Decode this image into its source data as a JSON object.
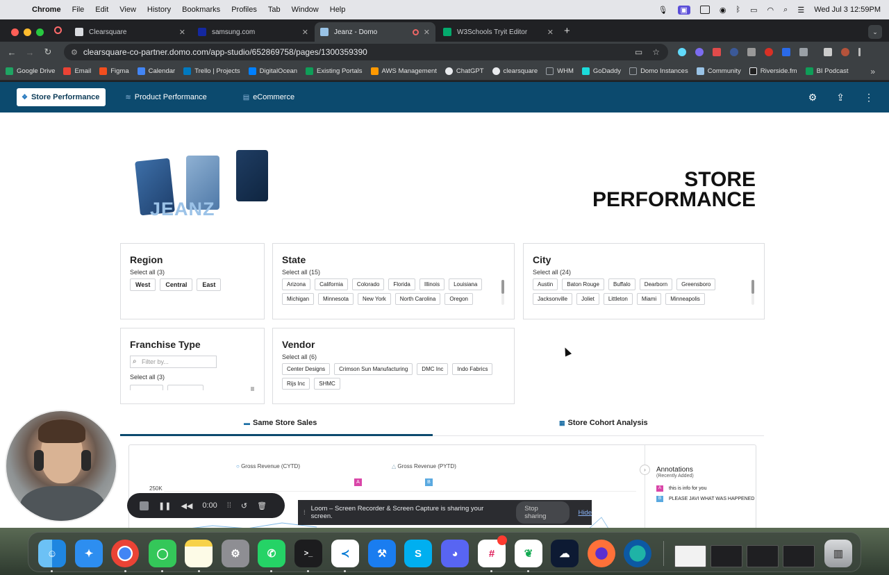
{
  "menubar": {
    "app": "Chrome",
    "items": [
      "File",
      "Edit",
      "View",
      "History",
      "Bookmarks",
      "Profiles",
      "Tab",
      "Window",
      "Help"
    ],
    "clock": "Wed Jul 3  12:59PM"
  },
  "tabs": [
    {
      "label": "Clearsquare",
      "color": "#dadce0"
    },
    {
      "label": "samsung.com",
      "color": "#1428a0"
    },
    {
      "label": "Jeanz - Domo",
      "color": "#99c3e6"
    },
    {
      "label": "W3Schools Tryit Editor",
      "color": "#04aa6d"
    }
  ],
  "address": {
    "url": "clearsquare-co-partner.domo.com/app-studio/652869758/pages/1300359390"
  },
  "bookmarks": [
    {
      "label": "Google Drive",
      "color": "#1fa463"
    },
    {
      "label": "Email",
      "color": "#ea4335"
    },
    {
      "label": "Figma",
      "color": "#f24e1e"
    },
    {
      "label": "Calendar",
      "color": "#4285f4"
    },
    {
      "label": "Trello | Projects",
      "color": "#0079bf"
    },
    {
      "label": "DigitalOcean",
      "color": "#0080ff"
    },
    {
      "label": "Existing Portals",
      "color": "#0f9d58"
    },
    {
      "label": "AWS Management",
      "color": "#ff9900"
    },
    {
      "label": "ChatGPT",
      "color": "#e8eaed"
    },
    {
      "label": "clearsquare",
      "color": "#e8eaed"
    },
    {
      "label": "WHM",
      "color": "#9aa0a6"
    },
    {
      "label": "GoDaddy",
      "color": "#1bdbdb"
    },
    {
      "label": "Domo Instances",
      "color": "#9aa0a6"
    },
    {
      "label": "Community",
      "color": "#99c3e6"
    },
    {
      "label": "Riverside.fm",
      "color": "#e8eaed"
    },
    {
      "label": "BI Podcast",
      "color": "#0f9d58"
    }
  ],
  "appnav": {
    "tabs": [
      "Store Performance",
      "Product Performance",
      "eCommerce"
    ]
  },
  "hero": {
    "brand": "JEANZ",
    "title_line1": "STORE",
    "title_line2": "PERFORMANCE"
  },
  "filters": {
    "region": {
      "title": "Region",
      "select_all": "Select all (3)",
      "options": [
        "West",
        "Central",
        "East"
      ]
    },
    "state": {
      "title": "State",
      "select_all": "Select all (15)",
      "options": [
        "Arizona",
        "California",
        "Colorado",
        "Florida",
        "Illinois",
        "Louisiana",
        "Michigan",
        "Minnesota",
        "New York",
        "North Carolina",
        "Oregon"
      ]
    },
    "city": {
      "title": "City",
      "select_all": "Select all (24)",
      "options": [
        "Austin",
        "Baton Rouge",
        "Buffalo",
        "Dearborn",
        "Greensboro",
        "Jacksonville",
        "Joliet",
        "Littleton",
        "Miami",
        "Minneapolis"
      ]
    },
    "franchise": {
      "title": "Franchise Type",
      "placeholder": "Filter by...",
      "select_all": "Select all (3)"
    },
    "vendor": {
      "title": "Vendor",
      "select_all": "Select all (6)",
      "options": [
        "Center Designs",
        "Crimson Sun Manufacturing",
        "DMC Inc",
        "Indo Fabrics",
        "Rijs Inc",
        "SHMC"
      ]
    }
  },
  "subtabs": [
    "Same Store Sales",
    "Store Cohort Analysis"
  ],
  "chart_data": {
    "type": "line",
    "series": [
      {
        "name": "Gross Revenue (CYTD)",
        "values": []
      },
      {
        "name": "Gross Revenue (PYTD)",
        "values": []
      }
    ],
    "y_ticks": [
      "250K"
    ],
    "markers": [
      "A",
      "B"
    ]
  },
  "annotations": {
    "title": "Annotations",
    "subtitle": "(Recently Added)",
    "items": [
      {
        "tag": "A",
        "text": "this is info for you",
        "color": "#d946a8"
      },
      {
        "tag": "B",
        "text": "PLEASE JAVI WHAT WAS HAPPENED",
        "color": "#5aa9e0"
      }
    ]
  },
  "recorder": {
    "time": "0:00"
  },
  "loom": {
    "message": "Loom – Screen Recorder & Screen Capture is sharing your screen.",
    "stop": "Stop sharing",
    "hide": "Hide"
  }
}
